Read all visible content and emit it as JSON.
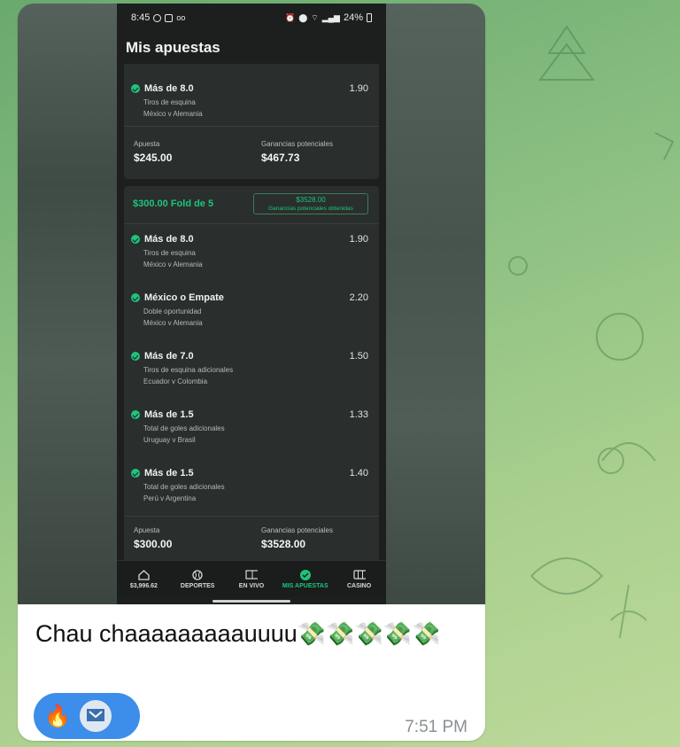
{
  "status_bar": {
    "time": "8:45",
    "battery": "24%"
  },
  "app_title": "Mis apuestas",
  "bet1": {
    "leg": {
      "pick": "Más de 8.0",
      "odds": "1.90",
      "market": "Tiros de esquina",
      "match": "México v Alemania"
    },
    "stake_label": "Apuesta",
    "stake": "$245.00",
    "payout_label": "Ganancias potenciales",
    "payout": "$467.73"
  },
  "bet2": {
    "title": "$300.00 Fold de 5",
    "won_amount": "$3528.00",
    "won_label": "Ganancias potenciales obtenidas",
    "legs": [
      {
        "pick": "Más de 8.0",
        "odds": "1.90",
        "market": "Tiros de esquina",
        "match": "México v Alemania"
      },
      {
        "pick": "México o Empate",
        "odds": "2.20",
        "market": "Doble oportunidad",
        "match": "México v Alemania"
      },
      {
        "pick": "Más de 7.0",
        "odds": "1.50",
        "market": "Tiros de esquina adicionales",
        "match": "Ecuador v Colombia"
      },
      {
        "pick": "Más de 1.5",
        "odds": "1.33",
        "market": "Total de goles adicionales",
        "match": "Uruguay v Brasil"
      },
      {
        "pick": "Más de 1.5",
        "odds": "1.40",
        "market": "Total de goles adicionales",
        "match": "Perú v Argentina"
      }
    ],
    "stake_label": "Apuesta",
    "stake": "$300.00",
    "payout_label": "Ganancias potenciales",
    "payout": "$3528.00"
  },
  "nav": [
    {
      "label": "$3,996.62",
      "icon": "home-icon"
    },
    {
      "label": "DEPORTES",
      "icon": "ball-icon"
    },
    {
      "label": "EN VIVO",
      "icon": "pitch-icon"
    },
    {
      "label": "MIS APUESTAS",
      "icon": "check-circle-icon",
      "active": true
    },
    {
      "label": "CASINO",
      "icon": "slot-icon"
    }
  ],
  "message": {
    "text": "Chau chaaaaaaaaauuuu",
    "emoji": "💸💸💸💸💸",
    "time": "7:51 PM"
  },
  "reactions": {
    "emoji": "🔥",
    "avatar": "avatar"
  },
  "colors": {
    "accent": "#1ec47c",
    "reaction_bg": "#3d8eea"
  }
}
